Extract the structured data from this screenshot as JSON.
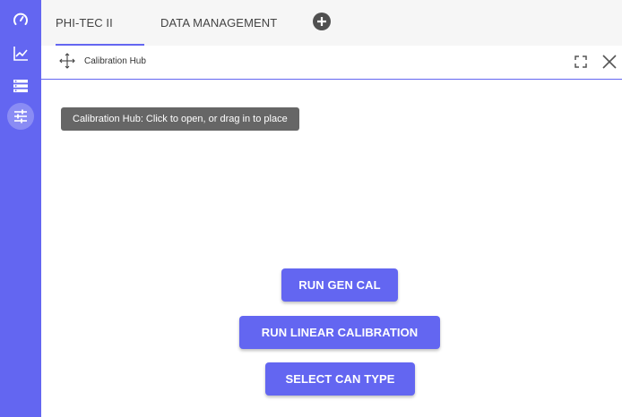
{
  "sidebar": {
    "items": [
      {
        "icon": "gauge-icon"
      },
      {
        "icon": "line-chart-icon"
      },
      {
        "icon": "list-icon"
      },
      {
        "icon": "sliders-icon"
      }
    ]
  },
  "tabs": [
    {
      "label": "PHI-TEC II"
    },
    {
      "label": "DATA MANAGEMENT"
    }
  ],
  "panel": {
    "title": "Calibration Hub",
    "tooltip": "Calibration Hub: Click to open, or drag in to place"
  },
  "buttons": {
    "run_gen_cal": "RUN GEN CAL",
    "run_linear_calibration": "RUN LINEAR CALIBRATION",
    "select_can_type": "SELECT CAN TYPE"
  },
  "colors": {
    "accent": "#6366f1",
    "tooltip_bg": "#666666"
  }
}
